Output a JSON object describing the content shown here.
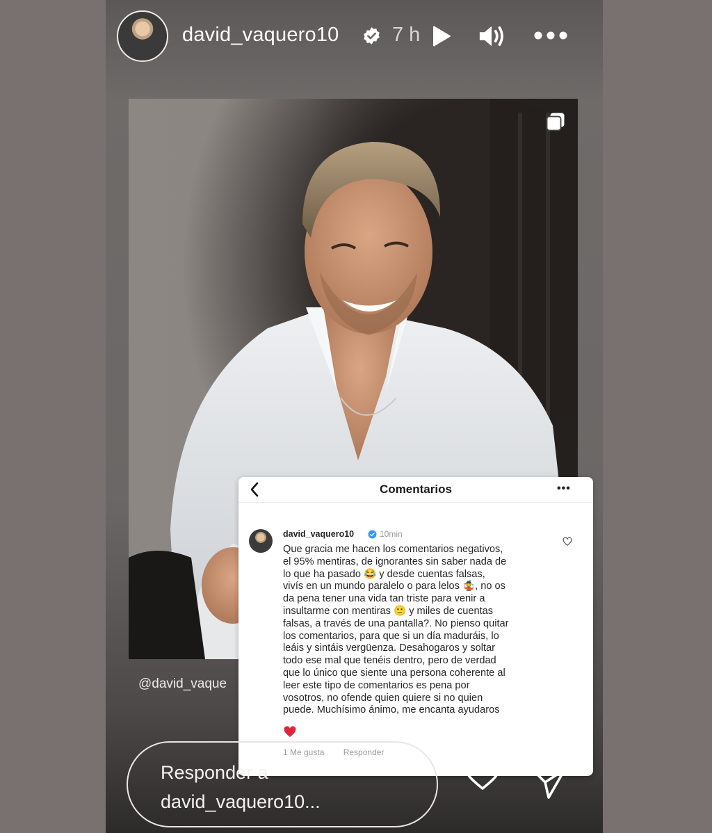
{
  "header": {
    "username": "david_vaquero10",
    "time": "7 h",
    "icons": [
      "verified-badge-icon",
      "play-icon",
      "sound-icon",
      "more-icon"
    ]
  },
  "post": {
    "handle": "@david_vaque",
    "icons": [
      "multiple-photos-icon"
    ]
  },
  "comments_screenshot": {
    "title": "Comentarios",
    "more": "•••",
    "comment": {
      "user": "david_vaquero10",
      "time": "10min",
      "text": "Que gracia me hacen los comentarios negativos,\nel 95% mentiras, de ignorantes sin saber nada de\nlo que ha pasado 😂 y desde cuentas falsas,\nvivís en un mundo paralelo o para lelos 🤹, no os\nda pena tener una vida tan triste para venir a\ninsultarme con mentiras 🙂 y miles de cuentas\nfalsas, a través de una pantalla?. No pienso quitar\nlos comentarios, para que si un día maduráis, lo\nleáis y sintáis vergüenza. Desahogaros y soltar\ntodo ese mal que tenéis dentro, pero de verdad\nque lo único que siente una persona coherente al\nleer este tipo de comentarios es pena por\nvosotros, no ofende quien quiere si no quien\npuede. Muchísimo ánimo, me encanta ayudaros",
      "likes": "1 Me gusta",
      "reply_label": "Responder"
    }
  },
  "footer": {
    "reply_placeholder": "Responder a\ndavid_vaquero10..."
  },
  "colors": {
    "background": "#7a7170",
    "verified": "#3897f0",
    "heart_red": "#e0243b"
  }
}
